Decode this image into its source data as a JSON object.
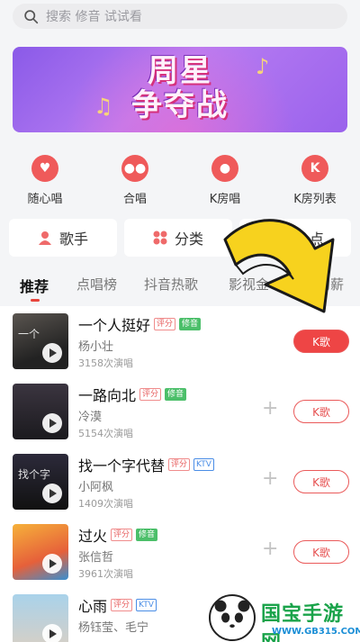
{
  "search": {
    "placeholder": "搜索 修音 试试看"
  },
  "banner": {
    "title_line1": "周星",
    "title_line2": "争夺战"
  },
  "quick_entries": [
    {
      "label": "随心唱",
      "icon": "heart-icon"
    },
    {
      "label": "合唱",
      "icon": "duet-mic-icon"
    },
    {
      "label": "K房唱",
      "icon": "mic-icon"
    },
    {
      "label": "K房列表",
      "icon": "k-room-list-icon",
      "glyph": "K"
    }
  ],
  "categories": [
    {
      "label": "歌手",
      "icon": "singer-icon"
    },
    {
      "label": "分类",
      "icon": "category-icon"
    },
    {
      "label": "点",
      "icon": ""
    }
  ],
  "tabs": [
    "推荐",
    "点唱榜",
    "抖音热歌",
    "影视金",
    "狗薪"
  ],
  "songs": [
    {
      "title": "一个人挺好",
      "tags": [
        "评分",
        "修音"
      ],
      "artist": "杨小壮",
      "count": "3158次演唱",
      "button": "K歌",
      "cover_text": "一个",
      "cover_color": "#3b3b3f"
    },
    {
      "title": "一路向北",
      "tags": [
        "评分",
        "修音"
      ],
      "artist": "冷漠",
      "count": "5154次演唱",
      "button": "K歌",
      "cover_text": "",
      "cover_color": "#2e2a2f"
    },
    {
      "title": "找一个字代替",
      "tags": [
        "评分",
        "KTV"
      ],
      "artist": "小阿枫",
      "count": "1409次演唱",
      "button": "K歌",
      "cover_text": "找个字",
      "cover_color": "#1e1c2a"
    },
    {
      "title": "过火",
      "tags": [
        "评分",
        "修音"
      ],
      "artist": "张信哲",
      "count": "3961次演唱",
      "button": "K歌",
      "cover_text": "",
      "cover_color": "#f2a030"
    },
    {
      "title": "心雨",
      "tags": [
        "评分",
        "KTV"
      ],
      "artist": "杨钰莹、毛宁",
      "count": "",
      "button": "K歌",
      "cover_text": "",
      "cover_color": "#7fb5d6"
    }
  ],
  "watermark": {
    "name": "国宝手游网",
    "url": "WWW.GB315.COM"
  },
  "colors": {
    "accent": "#ee4545",
    "banner": "#9a62ec"
  }
}
